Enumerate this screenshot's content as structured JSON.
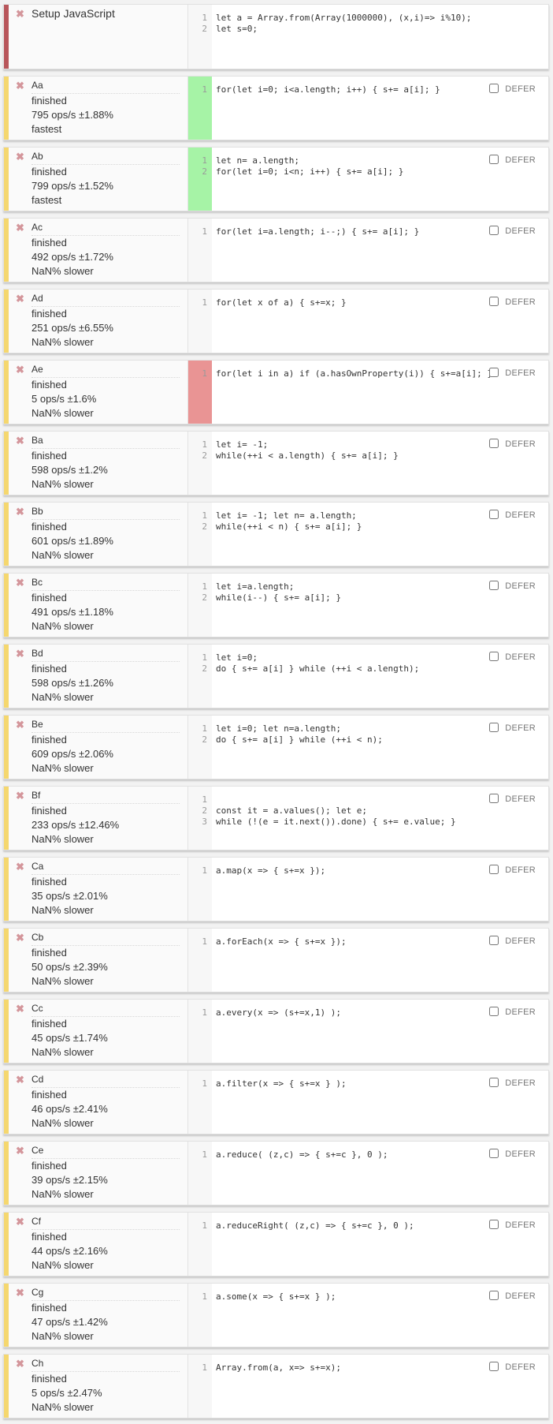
{
  "setup": {
    "name": "Setup JavaScript",
    "lines": [
      "let a = Array.from(Array(1000000), (x,i)=> i%10);",
      "let s=0;"
    ]
  },
  "tests": [
    {
      "name": "Aa",
      "status": "finished",
      "ops": "795 ops/s ±1.88%",
      "relative": "fastest",
      "rank": "fast",
      "lines": [
        "for(let i=0; i<a.length; i++) { s+= a[i]; }"
      ]
    },
    {
      "name": "Ab",
      "status": "finished",
      "ops": "799 ops/s ±1.52%",
      "relative": "fastest",
      "rank": "fast",
      "lines": [
        "let n= a.length;",
        "for(let i=0; i<n; i++) { s+= a[i]; }"
      ]
    },
    {
      "name": "Ac",
      "status": "finished",
      "ops": "492 ops/s ±1.72%",
      "relative": "NaN% slower",
      "rank": "none",
      "lines": [
        "for(let i=a.length; i--;) { s+= a[i]; }"
      ]
    },
    {
      "name": "Ad",
      "status": "finished",
      "ops": "251 ops/s ±6.55%",
      "relative": "NaN% slower",
      "rank": "none",
      "lines": [
        "for(let x of a) { s+=x; }"
      ]
    },
    {
      "name": "Ae",
      "status": "finished",
      "ops": "5 ops/s ±1.6%",
      "relative": "NaN% slower",
      "rank": "slowest",
      "lines": [
        "for(let i in a) if (a.hasOwnProperty(i)) { s+=a[i]; }"
      ]
    },
    {
      "name": "Ba",
      "status": "finished",
      "ops": "598 ops/s ±1.2%",
      "relative": "NaN% slower",
      "rank": "none",
      "lines": [
        "let i= -1;",
        "while(++i < a.length) { s+= a[i]; }"
      ]
    },
    {
      "name": "Bb",
      "status": "finished",
      "ops": "601 ops/s ±1.89%",
      "relative": "NaN% slower",
      "rank": "none",
      "lines": [
        "let i= -1; let n= a.length;",
        "while(++i < n) { s+= a[i]; }"
      ]
    },
    {
      "name": "Bc",
      "status": "finished",
      "ops": "491 ops/s ±1.18%",
      "relative": "NaN% slower",
      "rank": "none",
      "lines": [
        "let i=a.length;",
        "while(i--) { s+= a[i]; }"
      ]
    },
    {
      "name": "Bd",
      "status": "finished",
      "ops": "598 ops/s ±1.26%",
      "relative": "NaN% slower",
      "rank": "none",
      "lines": [
        "let i=0;",
        "do { s+= a[i] } while (++i < a.length);"
      ]
    },
    {
      "name": "Be",
      "status": "finished",
      "ops": "609 ops/s ±2.06%",
      "relative": "NaN% slower",
      "rank": "none",
      "lines": [
        "let i=0; let n=a.length;",
        "do { s+= a[i] } while (++i < n);"
      ]
    },
    {
      "name": "Bf",
      "status": "finished",
      "ops": "233 ops/s ±12.46%",
      "relative": "NaN% slower",
      "rank": "none",
      "lines": [
        "",
        "const it = a.values(); let e;",
        "while (!(e = it.next()).done) { s+= e.value; }"
      ]
    },
    {
      "name": "Ca",
      "status": "finished",
      "ops": "35 ops/s ±2.01%",
      "relative": "NaN% slower",
      "rank": "none",
      "lines": [
        "a.map(x => { s+=x });"
      ]
    },
    {
      "name": "Cb",
      "status": "finished",
      "ops": "50 ops/s ±2.39%",
      "relative": "NaN% slower",
      "rank": "none",
      "lines": [
        "a.forEach(x => { s+=x });"
      ]
    },
    {
      "name": "Cc",
      "status": "finished",
      "ops": "45 ops/s ±1.74%",
      "relative": "NaN% slower",
      "rank": "none",
      "lines": [
        "a.every(x => (s+=x,1) );"
      ]
    },
    {
      "name": "Cd",
      "status": "finished",
      "ops": "46 ops/s ±2.41%",
      "relative": "NaN% slower",
      "rank": "none",
      "lines": [
        "a.filter(x => { s+=x } );"
      ]
    },
    {
      "name": "Ce",
      "status": "finished",
      "ops": "39 ops/s ±2.15%",
      "relative": "NaN% slower",
      "rank": "none",
      "lines": [
        "a.reduce( (z,c) => { s+=c }, 0 );"
      ]
    },
    {
      "name": "Cf",
      "status": "finished",
      "ops": "44 ops/s ±2.16%",
      "relative": "NaN% slower",
      "rank": "none",
      "lines": [
        "a.reduceRight( (z,c) => { s+=c }, 0 );"
      ]
    },
    {
      "name": "Cg",
      "status": "finished",
      "ops": "47 ops/s ±1.42%",
      "relative": "NaN% slower",
      "rank": "none",
      "lines": [
        "a.some(x => { s+=x } );"
      ]
    },
    {
      "name": "Ch",
      "status": "finished",
      "ops": "5 ops/s ±2.47%",
      "relative": "NaN% slower",
      "rank": "none",
      "lines": [
        "Array.from(a, x=> s+=x);"
      ]
    }
  ],
  "labels": {
    "defer": "DEFER",
    "close_glyph": "✖"
  },
  "icons": {
    "close": "close-icon",
    "checkbox": "defer-checkbox"
  },
  "colors": {
    "stripe_setup": "#b8565b",
    "stripe_test": "#f5d76e",
    "fastest": "#a6f3a6",
    "slowest": "#e99494"
  }
}
